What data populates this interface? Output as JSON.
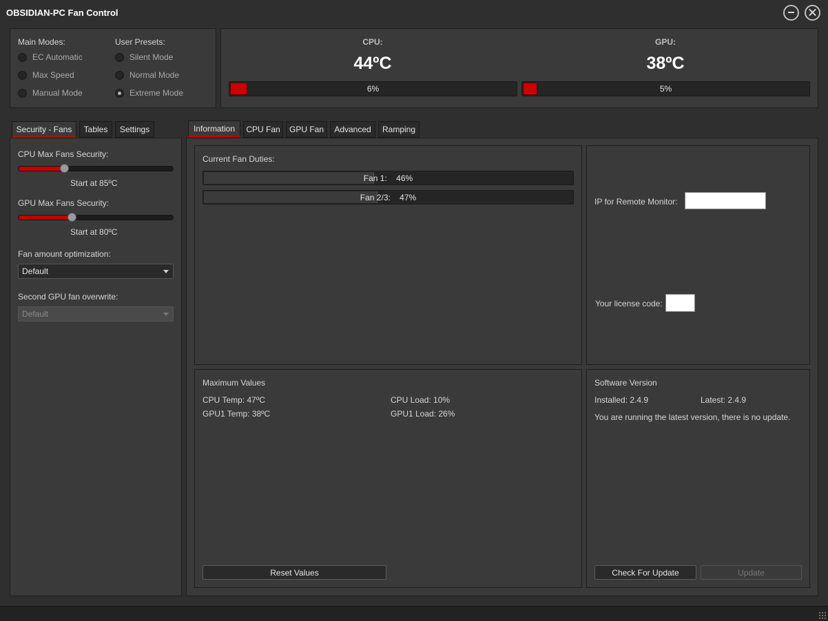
{
  "window": {
    "title": "OBSIDIAN-PC Fan Control"
  },
  "modes": {
    "main_label": "Main Modes:",
    "main": [
      {
        "label": "EC Automatic",
        "checked": false
      },
      {
        "label": "Max Speed",
        "checked": false
      },
      {
        "label": "Manual Mode",
        "checked": false
      }
    ],
    "presets_label": "User Presets:",
    "presets": [
      {
        "label": "Silent Mode",
        "checked": false
      },
      {
        "label": "Normal Mode",
        "checked": false
      },
      {
        "label": "Extreme Mode",
        "checked": true
      }
    ]
  },
  "cpu": {
    "label": "CPU:",
    "temp": "44ºC",
    "load": "6%",
    "load_pct": 6
  },
  "gpu": {
    "label": "GPU:",
    "temp": "38ºC",
    "load": "5%",
    "load_pct": 5
  },
  "accent_color": "#cc0000",
  "left_tabs": [
    {
      "label": "Security - Fans",
      "active": true
    },
    {
      "label": "Tables",
      "active": false
    },
    {
      "label": "Settings",
      "active": false
    }
  ],
  "security": {
    "cpu_label": "CPU Max Fans Security:",
    "cpu_start": "Start at 85ºC",
    "cpu_temp": 85,
    "gpu_label": "GPU Max Fans Security:",
    "gpu_start": "Start at 80ºC",
    "gpu_temp": 80,
    "fan_opt_label": "Fan amount optimization:",
    "fan_opt_value": "Default",
    "second_gpu_label": "Second GPU fan overwrite:",
    "second_gpu_value": "Default"
  },
  "right_tabs": [
    {
      "label": "Information",
      "active": true
    },
    {
      "label": "CPU Fan",
      "active": false
    },
    {
      "label": "GPU Fan",
      "active": false
    },
    {
      "label": "Advanced",
      "active": false
    },
    {
      "label": "Ramping",
      "active": false
    }
  ],
  "fan_duties": {
    "title": "Current Fan Duties:",
    "fans": [
      {
        "label": "Fan 1:",
        "value": "46%",
        "pct": 46
      },
      {
        "label": "Fan 2/3:",
        "value": "47%",
        "pct": 47
      }
    ]
  },
  "remote": {
    "ip_label": "IP for Remote Monitor:",
    "ip_value": "",
    "license_label": "Your license code:",
    "license_value": ""
  },
  "max_values": {
    "title": "Maximum Values",
    "cpu_temp": "CPU Temp: 47ºC",
    "gpu1_temp": "GPU1 Temp: 38ºC",
    "cpu_load": "CPU Load: 10%",
    "gpu1_load": "GPU1 Load: 26%",
    "reset_label": "Reset Values"
  },
  "software": {
    "title": "Software Version",
    "installed": "Installed: 2.4.9",
    "latest": "Latest: 2.4.9",
    "message": "You are running the latest version, there is no update.",
    "check_label": "Check For Update",
    "update_label": "Update"
  }
}
